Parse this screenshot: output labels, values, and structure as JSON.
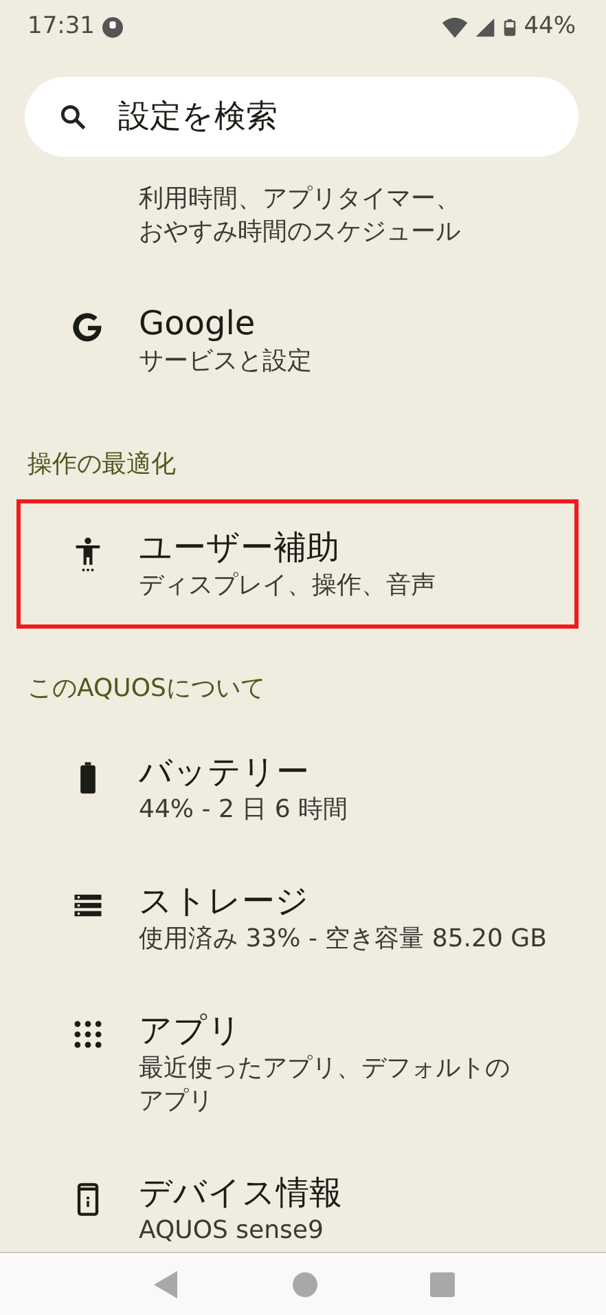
{
  "status_bar": {
    "time": "17:31",
    "battery": "44%"
  },
  "search": {
    "placeholder": "設定を検索"
  },
  "list": [
    {
      "kind": "item",
      "lines": [
        "利用時間、アプリタイマー、",
        "おやすみ時間のスケジュール"
      ],
      "highlighted": false
    },
    {
      "kind": "item",
      "title": "Google",
      "lines": [
        "サービスと設定"
      ],
      "highlighted": false
    },
    {
      "kind": "header",
      "title": "操作の最適化"
    },
    {
      "kind": "item",
      "title": "ユーザー補助",
      "lines": [
        "ディスプレイ、操作、音声"
      ],
      "highlighted": true
    },
    {
      "kind": "header",
      "title": "このAQUOSについて"
    },
    {
      "kind": "item",
      "title": "バッテリー",
      "lines": [
        "44% - 2 日 6 時間"
      ],
      "highlighted": false
    },
    {
      "kind": "item",
      "title": "ストレージ",
      "lines": [
        "使用済み 33% - 空き容量 85.20 GB"
      ],
      "highlighted": false
    },
    {
      "kind": "item",
      "title": "アプリ",
      "lines": [
        "最近使ったアプリ、デフォルトの",
        "アプリ"
      ],
      "highlighted": false
    },
    {
      "kind": "item",
      "title": "デバイス情報",
      "lines": [
        "AQUOS sense9"
      ],
      "highlighted": false
    }
  ]
}
